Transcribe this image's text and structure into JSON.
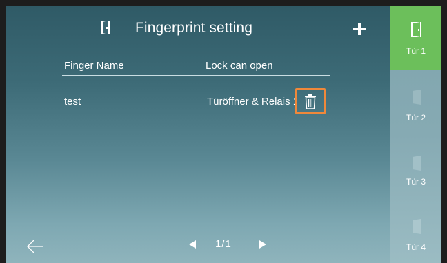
{
  "header": {
    "title": "Fingerprint setting",
    "door_icon": "door-icon",
    "add_icon": "plus-icon"
  },
  "table": {
    "columns": [
      "Finger Name",
      "Lock can open"
    ],
    "rows": [
      {
        "finger_name": "test",
        "lock_can_open": "Türöffner & Relais 1",
        "delete_icon": "trash-icon"
      }
    ]
  },
  "footer": {
    "back_icon": "arrow-left-icon",
    "page_text": "1/1",
    "prev_icon": "triangle-left-icon",
    "next_icon": "triangle-right-icon"
  },
  "sidebar": {
    "tabs": [
      {
        "label": "Tür 1",
        "active": true
      },
      {
        "label": "Tür 2",
        "active": false
      },
      {
        "label": "Tür 3",
        "active": false
      },
      {
        "label": "Tür 4",
        "active": false
      }
    ]
  },
  "colors": {
    "active_tab": "#6cbf5b",
    "highlight_border": "#f0883a"
  }
}
